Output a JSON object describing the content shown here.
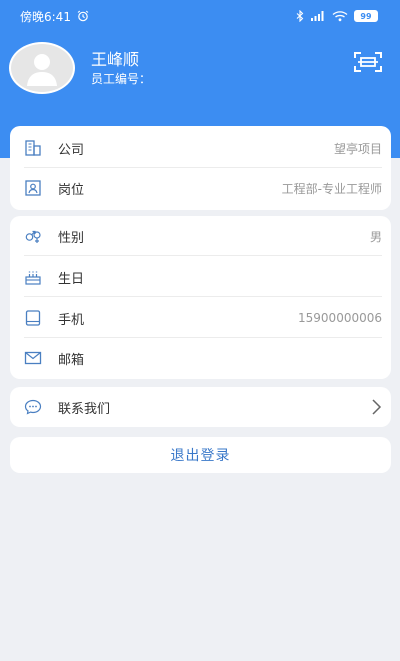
{
  "status_bar": {
    "time": "傍晚6:41",
    "alarm_icon": "alarm-clock-icon",
    "bluetooth_icon": "bluetooth-icon",
    "signal_icon": "cell-signal-icon",
    "wifi_icon": "wifi-icon",
    "battery": "99"
  },
  "profile": {
    "name": "王峰顺",
    "employee_no_label": "员工编号：",
    "scan_icon": "scan-icon"
  },
  "info_card": {
    "company_label": "公司",
    "company_value": "望亭项目",
    "position_label": "岗位",
    "position_value": "工程部-专业工程师"
  },
  "personal_card": {
    "gender_label": "性别",
    "gender_value": "男",
    "birthday_label": "生日",
    "birthday_value": "",
    "phone_label": "手机",
    "phone_value": "15900000006",
    "email_label": "邮箱",
    "email_value": ""
  },
  "contact": {
    "label": "联系我们"
  },
  "logout": {
    "label": "退出登录"
  },
  "colors": {
    "primary": "#3c8df2",
    "icon": "#4a7fc1",
    "background": "#eef0f4"
  }
}
